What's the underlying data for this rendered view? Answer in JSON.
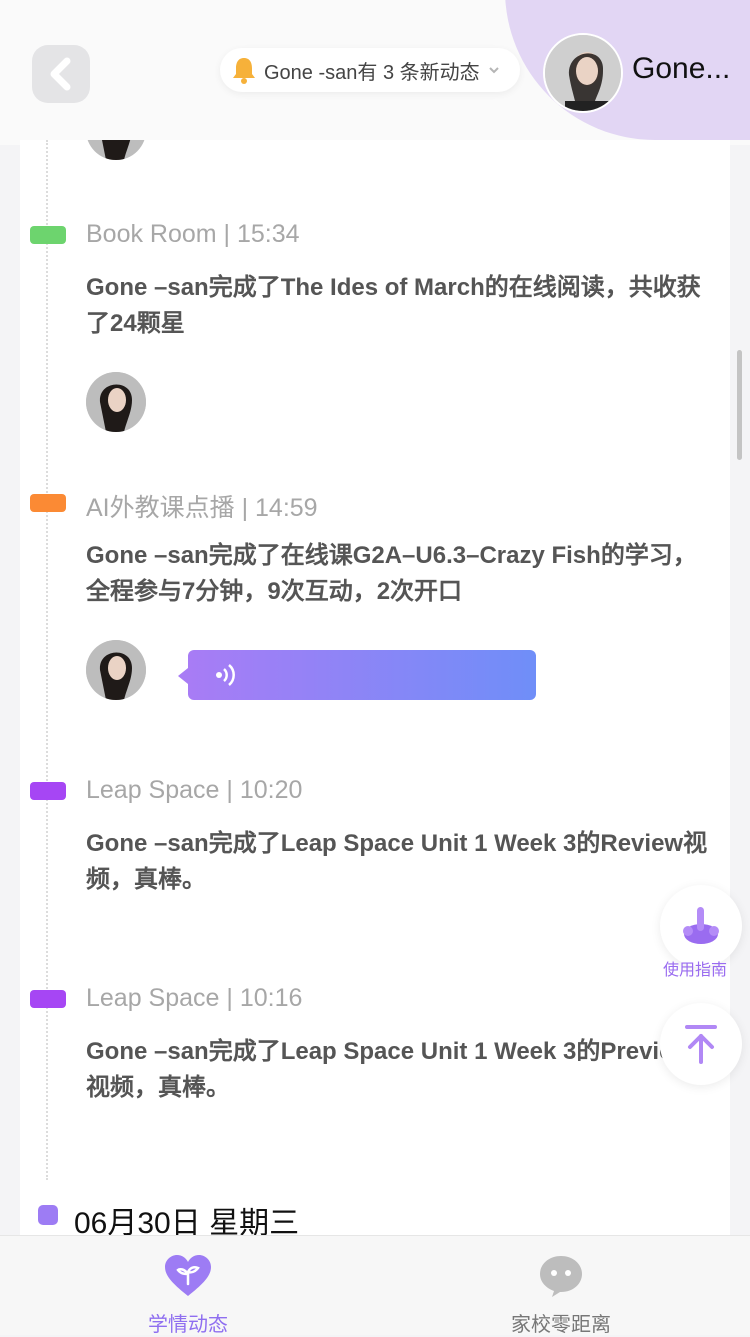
{
  "header": {
    "notice_text": "Gone -san有 3 条新动态",
    "user_name": "Gone..."
  },
  "entries": [
    {
      "tag": "Book Room",
      "time": "15:34",
      "meta": "Book Room | 15:34",
      "body": "Gone –san完成了The Ides of March的在线阅读，共收获了24颗星",
      "color": "#6dd46e"
    },
    {
      "tag": "AI外教课点播",
      "time": "14:59",
      "meta": "AI外教课点播 | 14:59",
      "body": "Gone –san完成了在线课G2A–U6.3–Crazy Fish的学习，全程参与7分钟，9次互动，2次开口",
      "color": "#fb8a34"
    },
    {
      "tag": "Leap Space",
      "time": "10:20",
      "meta": "Leap Space | 10:20",
      "body": "Gone –san完成了Leap Space  Unit 1 Week 3的Review视频，真棒。",
      "color": "#a646f4"
    },
    {
      "tag": "Leap Space",
      "time": "10:16",
      "meta": "Leap Space | 10:16",
      "body": "Gone –san完成了Leap Space  Unit 1 Week 3的Preview视频，真棒。",
      "color": "#a646f4"
    }
  ],
  "date_header": "06月30日  星期三",
  "floating": {
    "guide_label": "使用指南"
  },
  "tabs": [
    {
      "label": "学情动态",
      "active": true,
      "color": "#8f6ff0"
    },
    {
      "label": "家校零距离",
      "active": false,
      "color": "#777777"
    }
  ],
  "colors": {
    "accent": "#9d7cf4",
    "header_blob": "#e2d6f4"
  }
}
